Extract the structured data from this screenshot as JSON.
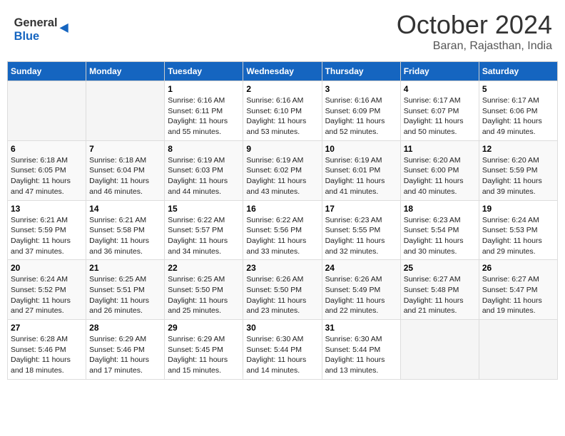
{
  "header": {
    "logo_line1": "General",
    "logo_line2": "Blue",
    "month_title": "October 2024",
    "subtitle": "Baran, Rajasthan, India"
  },
  "days_of_week": [
    "Sunday",
    "Monday",
    "Tuesday",
    "Wednesday",
    "Thursday",
    "Friday",
    "Saturday"
  ],
  "weeks": [
    [
      {
        "day": "",
        "info": ""
      },
      {
        "day": "",
        "info": ""
      },
      {
        "day": "1",
        "info": "Sunrise: 6:16 AM\nSunset: 6:11 PM\nDaylight: 11 hours and 55 minutes."
      },
      {
        "day": "2",
        "info": "Sunrise: 6:16 AM\nSunset: 6:10 PM\nDaylight: 11 hours and 53 minutes."
      },
      {
        "day": "3",
        "info": "Sunrise: 6:16 AM\nSunset: 6:09 PM\nDaylight: 11 hours and 52 minutes."
      },
      {
        "day": "4",
        "info": "Sunrise: 6:17 AM\nSunset: 6:07 PM\nDaylight: 11 hours and 50 minutes."
      },
      {
        "day": "5",
        "info": "Sunrise: 6:17 AM\nSunset: 6:06 PM\nDaylight: 11 hours and 49 minutes."
      }
    ],
    [
      {
        "day": "6",
        "info": "Sunrise: 6:18 AM\nSunset: 6:05 PM\nDaylight: 11 hours and 47 minutes."
      },
      {
        "day": "7",
        "info": "Sunrise: 6:18 AM\nSunset: 6:04 PM\nDaylight: 11 hours and 46 minutes."
      },
      {
        "day": "8",
        "info": "Sunrise: 6:19 AM\nSunset: 6:03 PM\nDaylight: 11 hours and 44 minutes."
      },
      {
        "day": "9",
        "info": "Sunrise: 6:19 AM\nSunset: 6:02 PM\nDaylight: 11 hours and 43 minutes."
      },
      {
        "day": "10",
        "info": "Sunrise: 6:19 AM\nSunset: 6:01 PM\nDaylight: 11 hours and 41 minutes."
      },
      {
        "day": "11",
        "info": "Sunrise: 6:20 AM\nSunset: 6:00 PM\nDaylight: 11 hours and 40 minutes."
      },
      {
        "day": "12",
        "info": "Sunrise: 6:20 AM\nSunset: 5:59 PM\nDaylight: 11 hours and 39 minutes."
      }
    ],
    [
      {
        "day": "13",
        "info": "Sunrise: 6:21 AM\nSunset: 5:59 PM\nDaylight: 11 hours and 37 minutes."
      },
      {
        "day": "14",
        "info": "Sunrise: 6:21 AM\nSunset: 5:58 PM\nDaylight: 11 hours and 36 minutes."
      },
      {
        "day": "15",
        "info": "Sunrise: 6:22 AM\nSunset: 5:57 PM\nDaylight: 11 hours and 34 minutes."
      },
      {
        "day": "16",
        "info": "Sunrise: 6:22 AM\nSunset: 5:56 PM\nDaylight: 11 hours and 33 minutes."
      },
      {
        "day": "17",
        "info": "Sunrise: 6:23 AM\nSunset: 5:55 PM\nDaylight: 11 hours and 32 minutes."
      },
      {
        "day": "18",
        "info": "Sunrise: 6:23 AM\nSunset: 5:54 PM\nDaylight: 11 hours and 30 minutes."
      },
      {
        "day": "19",
        "info": "Sunrise: 6:24 AM\nSunset: 5:53 PM\nDaylight: 11 hours and 29 minutes."
      }
    ],
    [
      {
        "day": "20",
        "info": "Sunrise: 6:24 AM\nSunset: 5:52 PM\nDaylight: 11 hours and 27 minutes."
      },
      {
        "day": "21",
        "info": "Sunrise: 6:25 AM\nSunset: 5:51 PM\nDaylight: 11 hours and 26 minutes."
      },
      {
        "day": "22",
        "info": "Sunrise: 6:25 AM\nSunset: 5:50 PM\nDaylight: 11 hours and 25 minutes."
      },
      {
        "day": "23",
        "info": "Sunrise: 6:26 AM\nSunset: 5:50 PM\nDaylight: 11 hours and 23 minutes."
      },
      {
        "day": "24",
        "info": "Sunrise: 6:26 AM\nSunset: 5:49 PM\nDaylight: 11 hours and 22 minutes."
      },
      {
        "day": "25",
        "info": "Sunrise: 6:27 AM\nSunset: 5:48 PM\nDaylight: 11 hours and 21 minutes."
      },
      {
        "day": "26",
        "info": "Sunrise: 6:27 AM\nSunset: 5:47 PM\nDaylight: 11 hours and 19 minutes."
      }
    ],
    [
      {
        "day": "27",
        "info": "Sunrise: 6:28 AM\nSunset: 5:46 PM\nDaylight: 11 hours and 18 minutes."
      },
      {
        "day": "28",
        "info": "Sunrise: 6:29 AM\nSunset: 5:46 PM\nDaylight: 11 hours and 17 minutes."
      },
      {
        "day": "29",
        "info": "Sunrise: 6:29 AM\nSunset: 5:45 PM\nDaylight: 11 hours and 15 minutes."
      },
      {
        "day": "30",
        "info": "Sunrise: 6:30 AM\nSunset: 5:44 PM\nDaylight: 11 hours and 14 minutes."
      },
      {
        "day": "31",
        "info": "Sunrise: 6:30 AM\nSunset: 5:44 PM\nDaylight: 11 hours and 13 minutes."
      },
      {
        "day": "",
        "info": ""
      },
      {
        "day": "",
        "info": ""
      }
    ]
  ]
}
